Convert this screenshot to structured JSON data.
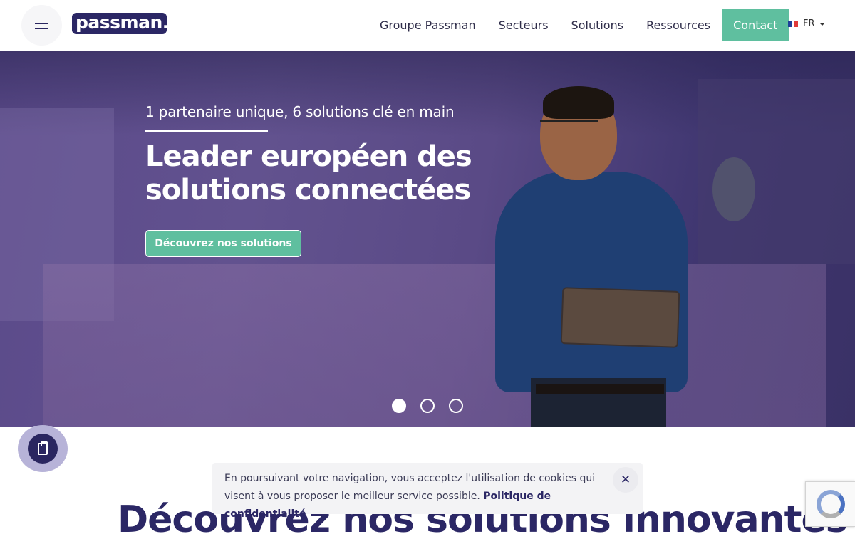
{
  "header": {
    "logo_text": "passman.",
    "nav": [
      {
        "label": "Groupe Passman"
      },
      {
        "label": "Secteurs"
      },
      {
        "label": "Solutions"
      },
      {
        "label": "Ressources"
      }
    ],
    "contact_label": "Contact",
    "language": "FR"
  },
  "hero": {
    "subtitle": "1 partenaire unique, 6 solutions clé en main",
    "title_line1": "Leader européen des",
    "title_line2": "solutions connectées",
    "cta_label": "Découvrez nos solutions",
    "slides_total": 3,
    "active_slide": 1
  },
  "section": {
    "title_regular": "Découvrez ",
    "title_bold": "nos solutions innovantes"
  },
  "cookie": {
    "text": "En poursuivant votre navigation, vous acceptez l'utilisation de cookies qui visent à vous proposer le meilleur service possible.",
    "link_label": "Politique de confidentialité",
    "close_symbol": "✕"
  },
  "icons": {
    "menu": "menu-icon",
    "flag": "france-flag-icon",
    "floating": "clipboard-icon",
    "recaptcha": "recaptcha-icon"
  },
  "colors": {
    "brand": "#2b2765",
    "accent": "#5fbf9f",
    "hero_overlay": "#5b4a8a"
  }
}
